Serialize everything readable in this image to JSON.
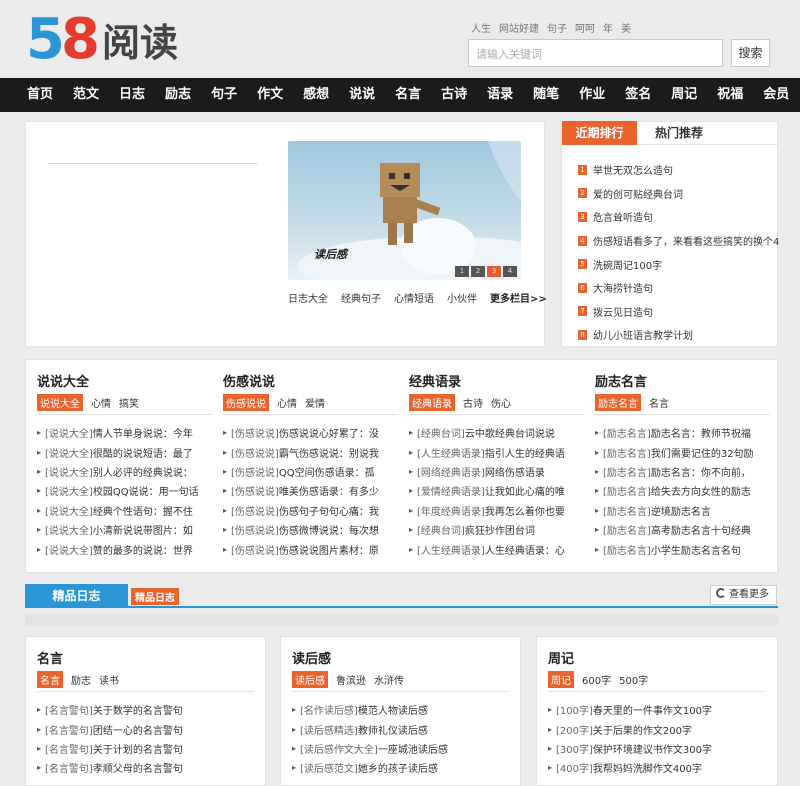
{
  "logo": {
    "five": "5",
    "eight": "8",
    "text": "阅读"
  },
  "hot_words": [
    "人生",
    "网站好建",
    "句子",
    "呵呵",
    "年",
    "美"
  ],
  "search": {
    "placeholder": "请输入关键词",
    "button": "搜索"
  },
  "nav": [
    "首页",
    "范文",
    "日志",
    "励志",
    "句子",
    "作文",
    "感想",
    "说说",
    "名言",
    "古诗",
    "语录",
    "随笔",
    "作业",
    "签名",
    "周记",
    "祝福",
    "会员"
  ],
  "slider": {
    "caption": "读后感",
    "pages": [
      "1",
      "2",
      "3",
      "4"
    ],
    "links": [
      "日志大全",
      "经典句子",
      "心情短语",
      "小伙伴"
    ],
    "more": "更多栏目>>"
  },
  "ranking": {
    "tab_recent": "近期排行",
    "tab_hot": "热门推荐",
    "items": [
      {
        "num": "1",
        "text": "举世无双怎么造句"
      },
      {
        "num": "2",
        "text": "爱的创可贴经典台词"
      },
      {
        "num": "3",
        "text": "危言耸听造句"
      },
      {
        "num": "4",
        "text": "伤感短语看多了，来看看这些搞笑的换个4"
      },
      {
        "num": "5",
        "text": "洗碗周记100字"
      },
      {
        "num": "6",
        "text": "大海捞针造句"
      },
      {
        "num": "7",
        "text": "拨云见日造句"
      },
      {
        "num": "8",
        "text": "幼儿小班语言教学计划"
      }
    ]
  },
  "columns": [
    {
      "title": "说说大全",
      "tags": [
        "说说大全",
        "心情",
        "搞笑"
      ],
      "items": [
        {
          "cat": "[说说大全]",
          "text": "情人节单身说说：今年"
        },
        {
          "cat": "[说说大全]",
          "text": "很酷的说说短语：最了"
        },
        {
          "cat": "[说说大全]",
          "text": "别人必评的经典说说："
        },
        {
          "cat": "[说说大全]",
          "text": "校园QQ说说：用一句话"
        },
        {
          "cat": "[说说大全]",
          "text": "经典个性语句：握不住"
        },
        {
          "cat": "[说说大全]",
          "text": "小清新说说带图片：如"
        },
        {
          "cat": "[说说大全]",
          "text": "赞的最多的说说：世界"
        }
      ]
    },
    {
      "title": "伤感说说",
      "tags": [
        "伤感说说",
        "心情",
        "爱情"
      ],
      "items": [
        {
          "cat": "[伤感说说]",
          "text": "伤感说说心好累了：没"
        },
        {
          "cat": "[伤感说说]",
          "text": "霸气伤感说说：别说我"
        },
        {
          "cat": "[伤感说说]",
          "text": "QQ空间伤感语录：孤"
        },
        {
          "cat": "[伤感说说]",
          "text": "唯美伤感语录：有多少"
        },
        {
          "cat": "[伤感说说]",
          "text": "伤感句子句句心痛：我"
        },
        {
          "cat": "[伤感说说]",
          "text": "伤感微博说说：每次想"
        },
        {
          "cat": "[伤感说说]",
          "text": "伤感说说图片素材：原"
        }
      ]
    },
    {
      "title": "经典语录",
      "tags": [
        "经典语录",
        "古诗",
        "伤心"
      ],
      "items": [
        {
          "cat": "[经典台词]",
          "text": "云中歌经典台词说说"
        },
        {
          "cat": "[人生经典语录]",
          "text": "指引人生的经典语"
        },
        {
          "cat": "[网络经典语录]",
          "text": "网络伤感语录"
        },
        {
          "cat": "[爱情经典语录]",
          "text": "让我如此心痛的唯"
        },
        {
          "cat": "[年度经典语录]",
          "text": "我再怎么着你也要"
        },
        {
          "cat": "[经典台词]",
          "text": "疯狂抄作团台词"
        },
        {
          "cat": "[人生经典语录]",
          "text": "人生经典语录：心"
        }
      ]
    },
    {
      "title": "励志名言",
      "tags": [
        "励志名言",
        "名言"
      ],
      "items": [
        {
          "cat": "[励志名言]",
          "text": "励志名言：教师节祝福"
        },
        {
          "cat": "[励志名言]",
          "text": "我们需要记住的32句励"
        },
        {
          "cat": "[励志名言]",
          "text": "励志名言：你不向前，"
        },
        {
          "cat": "[励志名言]",
          "text": "给失去方向女性的励志"
        },
        {
          "cat": "[励志名言]",
          "text": "逆境励志名言"
        },
        {
          "cat": "[励志名言]",
          "text": "高考励志名言十句经典"
        },
        {
          "cat": "[励志名言]",
          "text": "小学生励志名言名句"
        }
      ]
    }
  ],
  "diary_bar": {
    "tab": "精品日志",
    "tag": "精品日志",
    "more": "查看更多"
  },
  "bottom_columns": [
    {
      "title": "名言",
      "tags": [
        "名言",
        "励志",
        "读书"
      ],
      "items": [
        {
          "cat": "[名言警句]",
          "text": "关于数学的名言警句"
        },
        {
          "cat": "[名言警句]",
          "text": "团结一心的名言警句"
        },
        {
          "cat": "[名言警句]",
          "text": "关于计划的名言警句"
        },
        {
          "cat": "[名言警句]",
          "text": "孝顺父母的名言警句"
        }
      ]
    },
    {
      "title": "读后感",
      "tags": [
        "读后感",
        "鲁滨逊",
        "水浒传"
      ],
      "items": [
        {
          "cat": "[名作读后感]",
          "text": "模范人物读后感"
        },
        {
          "cat": "[读后感精选]",
          "text": "教师礼仪读后感"
        },
        {
          "cat": "[读后感作文大全]",
          "text": "一座城池读后感"
        },
        {
          "cat": "[读后感范文]",
          "text": "她乡的孩子读后感"
        }
      ]
    },
    {
      "title": "周记",
      "tags": [
        "周记",
        "600字",
        "500字"
      ],
      "items": [
        {
          "cat": "[100字]",
          "text": "春天里的一件事作文100字"
        },
        {
          "cat": "[200字]",
          "text": "关于后果的作文200字"
        },
        {
          "cat": "[300字]",
          "text": "保护环境建议书作文300字"
        },
        {
          "cat": "[400字]",
          "text": "我帮妈妈洗脚作文400字"
        }
      ]
    }
  ],
  "colors": {
    "brand_blue": "#2a96d6",
    "brand_red": "#e43b2c",
    "accent_orange": "#e8642c",
    "nav_bg": "#1b1b1b"
  }
}
